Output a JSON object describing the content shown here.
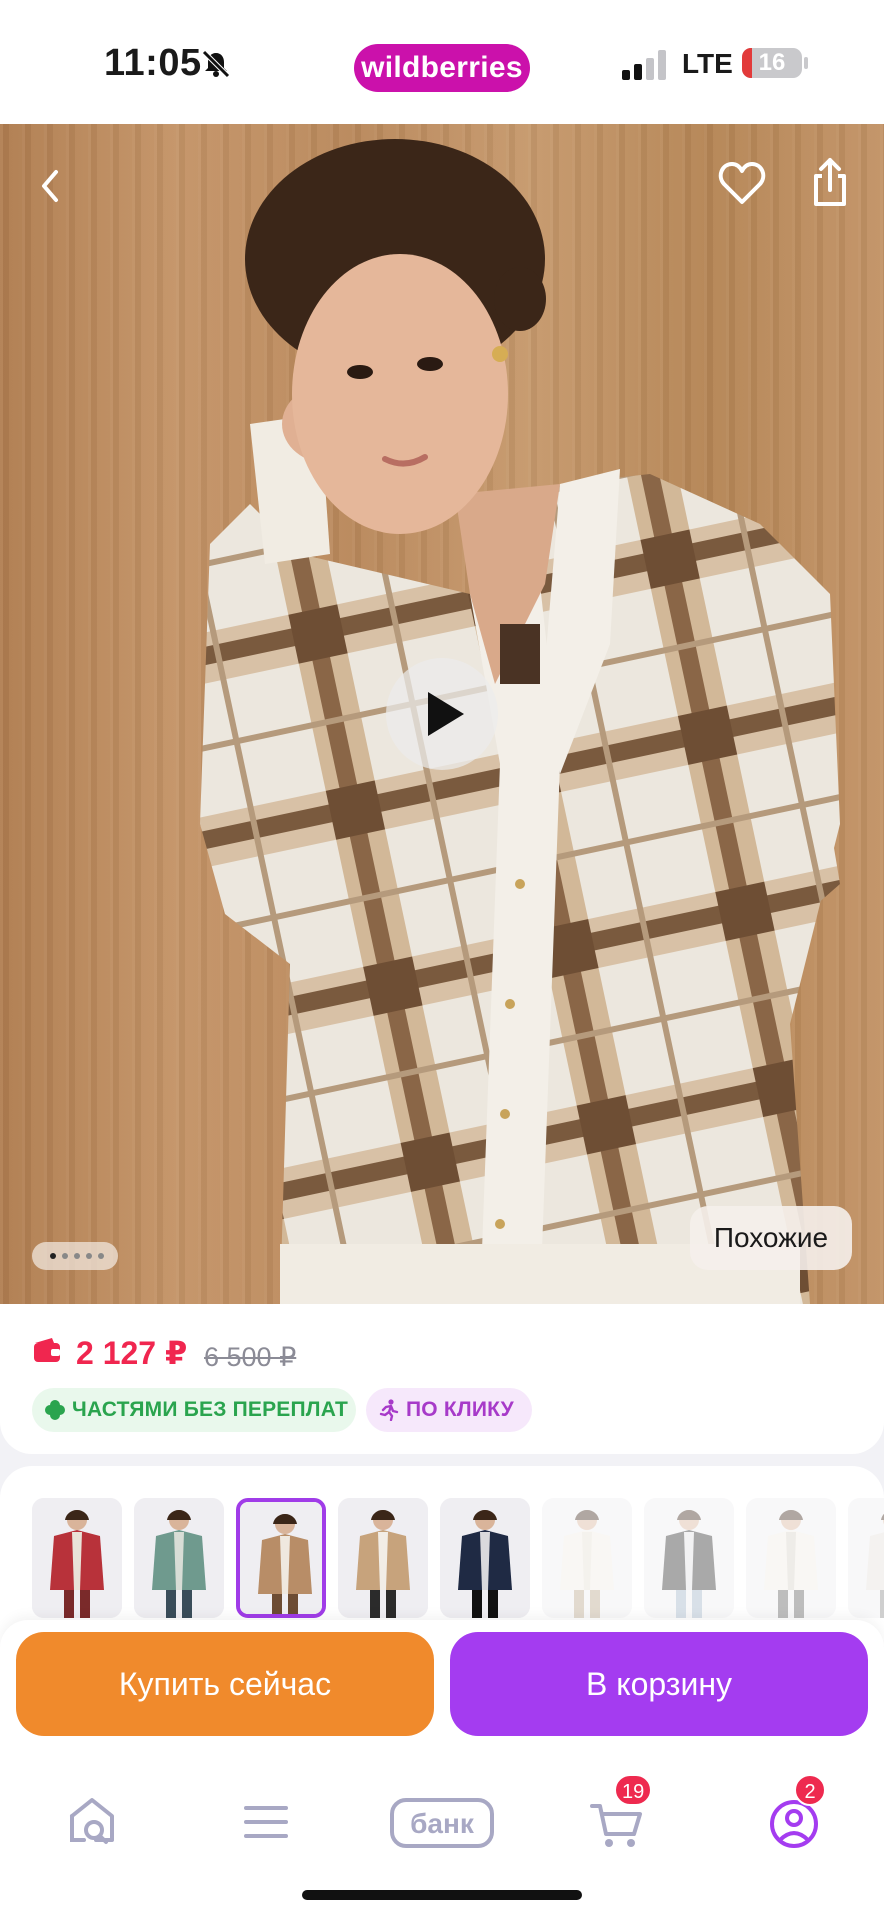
{
  "status_bar": {
    "time": "11:05",
    "brand": "wildberries",
    "network": "LTE",
    "battery": "16",
    "battery_level": 0.16
  },
  "hero": {
    "similar_label": "Похожие",
    "photo_count": 5,
    "active_photo": 0,
    "icons": [
      "back-icon",
      "heart-icon",
      "share-icon",
      "play-icon"
    ]
  },
  "price": {
    "current": "2 127 ₽",
    "old": "6 500 ₽",
    "badges": {
      "installment": "ЧАСТЯМИ БЕЗ ПЕРЕПЛАТ",
      "one_click": "ПО КЛИКУ"
    }
  },
  "variants": {
    "count": 9,
    "selected_index": 2
  },
  "actions": {
    "buy_now": "Купить сейчас",
    "add_to_cart": "В корзину"
  },
  "nav": {
    "items": [
      "home-search-icon",
      "menu-icon",
      "bank-icon",
      "cart-icon",
      "profile-icon"
    ],
    "bank_label": "банк",
    "cart_badge": "19",
    "profile_badge": "2"
  },
  "colors": {
    "brand": "#cb11ab",
    "price": "#f0264f",
    "buy_now": "#f08a2c",
    "add_to_cart": "#a43cf0",
    "installment_green": "#2aa44e",
    "click_purple": "#a73ac9"
  }
}
